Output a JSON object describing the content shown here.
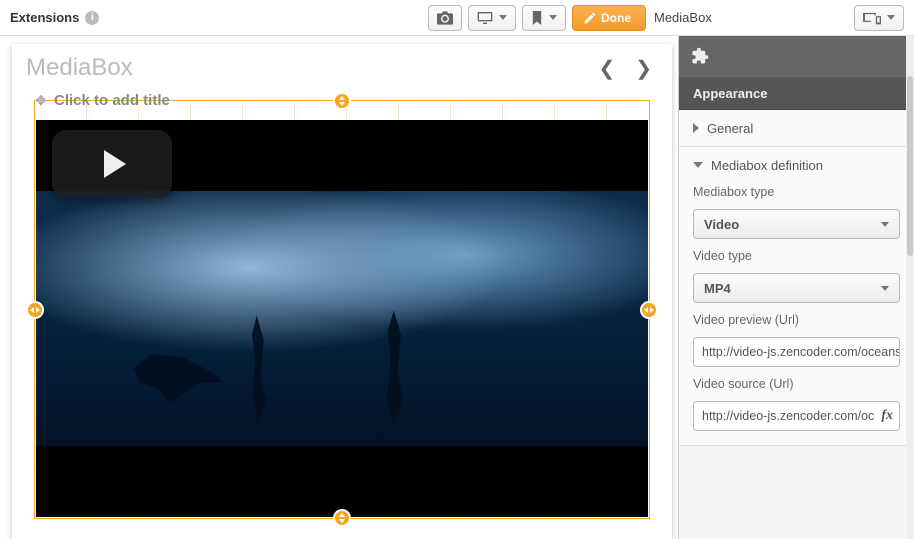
{
  "topbar": {
    "extensions_label": "Extensions",
    "done_label": "Done",
    "object_name": "MediaBox"
  },
  "canvas": {
    "card_title": "MediaBox",
    "title_placeholder": "Click to add title"
  },
  "sidebar": {
    "panel_title": "Appearance",
    "sections": {
      "general": "General",
      "mediabox": "Mediabox definition"
    },
    "fields": {
      "mediabox_type_label": "Mediabox type",
      "mediabox_type_value": "Video",
      "video_type_label": "Video type",
      "video_type_value": "MP4",
      "video_preview_label": "Video preview (Url)",
      "video_preview_value": "http://video-js.zencoder.com/oceans-",
      "video_source_label": "Video source (Url)",
      "video_source_value": "http://video-js.zencoder.com/oce"
    }
  }
}
